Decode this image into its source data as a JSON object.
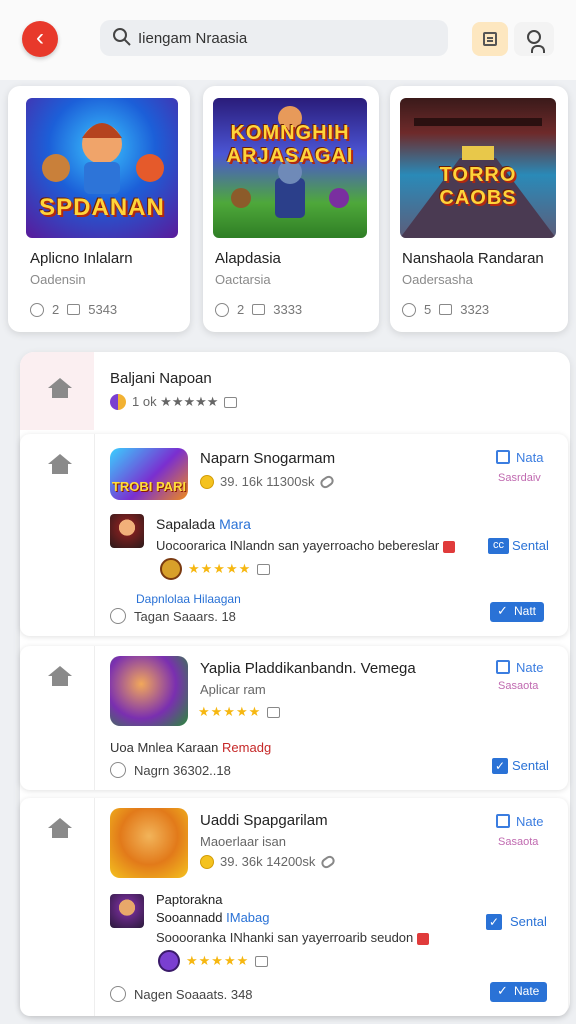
{
  "topbar": {
    "back_icon": "chevron-left-icon",
    "search_value": "Iiengam Nraasia",
    "search_icon": "search-icon",
    "btn1_icon": "list-icon",
    "btn2_icon": "user-icon",
    "colors": {
      "back": "#e8392b",
      "btn1_bg": "#fde7c0"
    }
  },
  "featured": [
    {
      "title": "Aplicno Inlalarn",
      "sub": "Oadensin",
      "stat1": "2",
      "stat2": "5343",
      "art": "SPDANAN"
    },
    {
      "title": "Alapdasia",
      "sub": "Oactarsia",
      "stat1": "2",
      "stat2": "3333",
      "art": "KOMNGHIH ARJASAGAI"
    },
    {
      "title": "Nanshaola Randaran",
      "sub": "Oadersasha",
      "stat1": "5",
      "stat2": "3323",
      "art": "TORRO CAOBS"
    }
  ],
  "list": {
    "header": {
      "title": "Baljani Napoan",
      "rating_text": "1 ok ★★★★★",
      "icon": "home-icon"
    },
    "items": [
      {
        "name": "Naparn Snogarmam",
        "meta": "39. 16k 11300sk",
        "check_label": "Nata",
        "pink_label": "Sasrdaiv",
        "dev_name": "Sapalada",
        "dev_tag": "Mara",
        "desc": "Uocoorarica INlandn san yayerroacho bebereslar",
        "tag_label": "cc",
        "sent_label": "Sental",
        "stars": "★★★★★",
        "dev_link": "Dapnlolaa Hilaagan",
        "foot_text": "Tagan Saaars. 18",
        "action_label": "Natt",
        "icon_art": "TROBI PARI"
      },
      {
        "name": "Yaplia Pladdikanbandn. Vemega",
        "sub": "Aplicar ram",
        "check_label": "Nate",
        "pink_label": "Sasaota",
        "stars": "★★★★★",
        "dev_line": "Uoa Mnlea Karaan",
        "dev_red": "Remadg",
        "foot_text": "Nagrn 36302..18",
        "action_label": "Sental"
      },
      {
        "name": "Uaddi Spapgarilam",
        "sub": "Maoerlaar isan",
        "meta": "39. 36k 14200sk",
        "check_label": "Nate",
        "pink_label": "Sasaota",
        "dev_name": "Paptorakna",
        "dev_line2": "Sooannadd",
        "dev_tag": "IMabag",
        "desc": "Sooooranka INhanki san yayerroarib seudon",
        "sent_label": "Sental",
        "stars": "★★★★★",
        "foot_text": "Nagen Soaaats. 348",
        "action_label": "Nate"
      }
    ]
  }
}
